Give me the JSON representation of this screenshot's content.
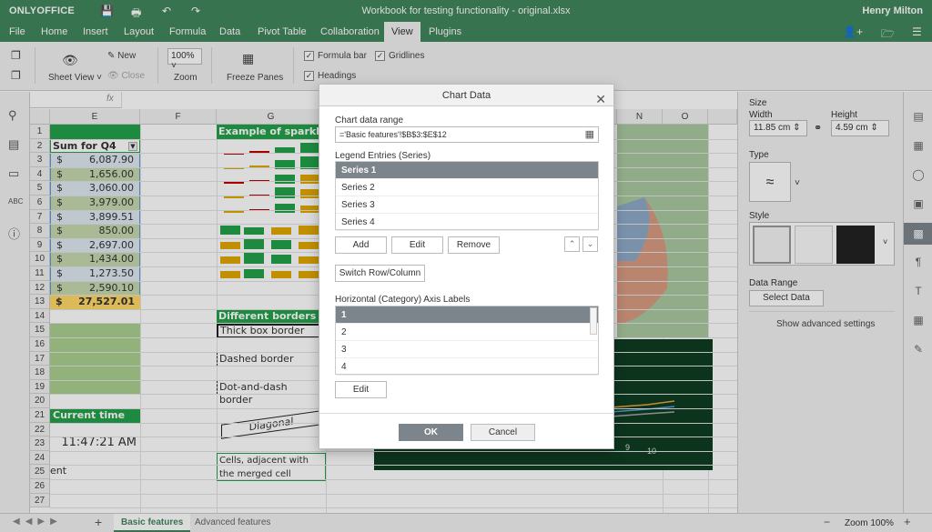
{
  "titlebar": {
    "logo": "ONLYOFFICE",
    "title": "Workbook for testing functionality - original.xlsx",
    "user": "Henry Milton"
  },
  "menu": {
    "items": [
      "File",
      "Home",
      "Insert",
      "Layout",
      "Formula",
      "Data",
      "Pivot Table",
      "Collaboration",
      "View",
      "Plugins"
    ],
    "active": "View"
  },
  "toolbar": {
    "new": "New",
    "close": "Close",
    "sheet_view": "Sheet View",
    "zoom_value": "100%",
    "zoom": "Zoom",
    "freeze": "Freeze Panes",
    "formula_bar": "Formula bar",
    "headings": "Headings",
    "gridlines": "Gridlines"
  },
  "formula": {
    "fx": "fx"
  },
  "grid": {
    "columns": [
      "E",
      "F",
      "G",
      "N",
      "O"
    ],
    "rows": [
      "1",
      "2",
      "3",
      "4",
      "5",
      "6",
      "7",
      "8",
      "9",
      "10",
      "11",
      "12",
      "13",
      "14",
      "15",
      "16",
      "17",
      "18",
      "19",
      "20",
      "21",
      "22",
      "23",
      "24",
      "25",
      "26",
      "27"
    ],
    "sum_header": "Sum for Q4",
    "currency": "$",
    "values": [
      "6,087.90",
      "1,656.00",
      "3,060.00",
      "3,979.00",
      "3,899.51",
      "850.00",
      "2,697.00",
      "1,434.00",
      "1,273.50",
      "2,590.10"
    ],
    "total": "27,527.01",
    "sparklines_title": "Example of sparklines",
    "borders_title": "Different borders",
    "thick": "Thick box border",
    "dashed": "Dashed border",
    "dotdash": "Dot-and-dash border",
    "diagonal": "Diagonal",
    "current_time_title": "Current time",
    "time": "11:47:21 AM",
    "partial": "ent",
    "merged_1": "Cells, adjacent with",
    "merged_2": "the merged cell",
    "chart_ticks": [
      "9",
      "10"
    ]
  },
  "right_panel": {
    "size": "Size",
    "width": "Width",
    "height": "Height",
    "width_val": "11.85 cm",
    "height_val": "4.59 cm",
    "type": "Type",
    "style": "Style",
    "data_range": "Data Range",
    "select_data": "Select Data",
    "advanced": "Show advanced settings"
  },
  "status": {
    "sheet_active": "Basic features",
    "sheet_other": "Advanced features",
    "zoom": "Zoom 100%"
  },
  "dialog": {
    "title": "Chart Data",
    "range_label": "Chart data range",
    "range_value": "='Basic features'!$B$3:$E$12",
    "legend_label": "Legend Entries (Series)",
    "series": [
      "Series 1",
      "Series 2",
      "Series 3",
      "Series 4"
    ],
    "add": "Add",
    "edit": "Edit",
    "remove": "Remove",
    "switch": "Switch Row/Column",
    "axis_label": "Horizontal (Category) Axis Labels",
    "categories": [
      "1",
      "2",
      "3",
      "4"
    ],
    "axis_edit": "Edit",
    "ok": "OK",
    "cancel": "Cancel"
  },
  "colors": {
    "brand": "#40865c",
    "selection": "#7d858c",
    "header_green": "#22a14a",
    "row_green": "#a9d08e"
  }
}
